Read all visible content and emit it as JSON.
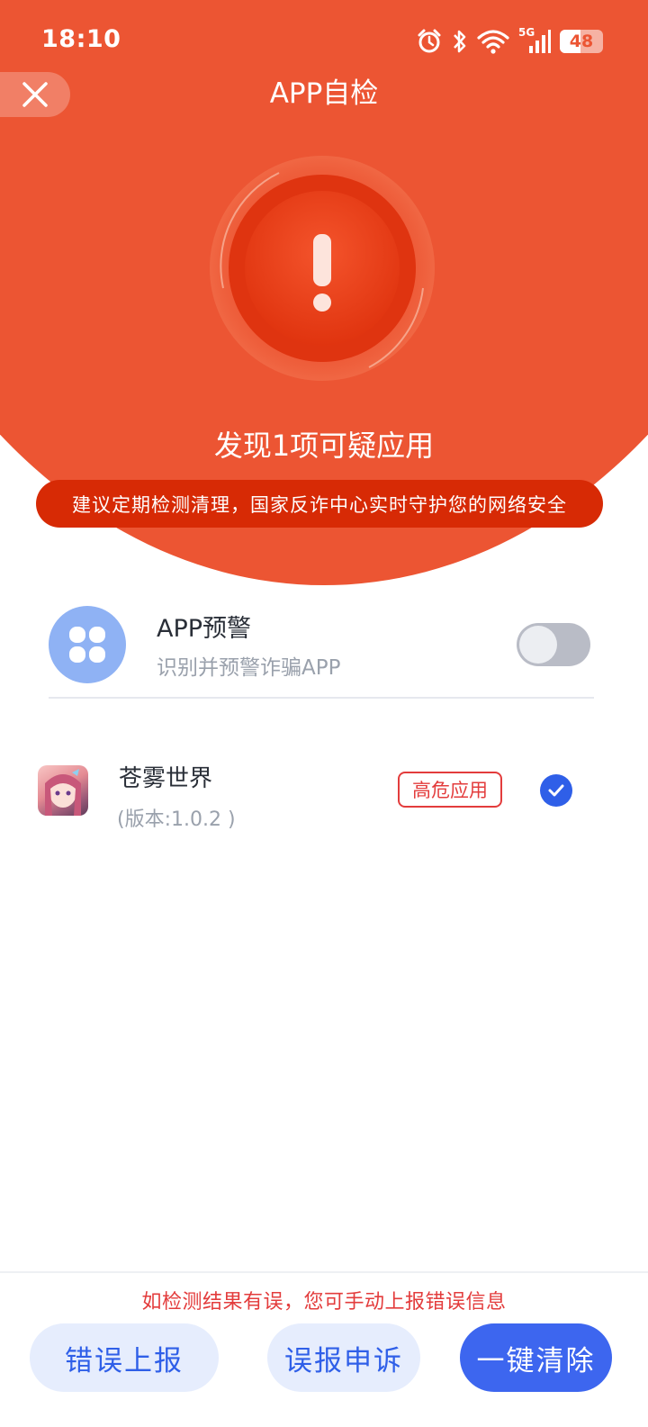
{
  "status_bar": {
    "time": "18:10",
    "battery": "48",
    "network": "5G",
    "icons": [
      "alarm-icon",
      "bluetooth-icon",
      "wifi-icon",
      "signal-icon",
      "battery-icon"
    ]
  },
  "header": {
    "title": "APP自检",
    "close_icon": "close-icon"
  },
  "result": {
    "title": "发现1项可疑应用",
    "advice": "建议定期检测清理，国家反诈中心实时守护您的网络安全"
  },
  "feature": {
    "title": "APP预警",
    "subtitle": "识别并预警诈骗APP",
    "enabled": false
  },
  "apps": [
    {
      "name": "苍雾世界",
      "version": "(版本:1.0.2 )",
      "risk": "高危应用",
      "selected": true
    }
  ],
  "footer": {
    "hint": "如检测结果有误，您可手动上报错误信息",
    "report_label": "错误上报",
    "appeal_label": "误报申诉",
    "clean_label": "一键清除"
  },
  "colors": {
    "header_bg": "#ec5533",
    "advice_bg": "#d72a05",
    "accent_blue": "#3d66ef",
    "danger_red": "#e33c3c"
  }
}
